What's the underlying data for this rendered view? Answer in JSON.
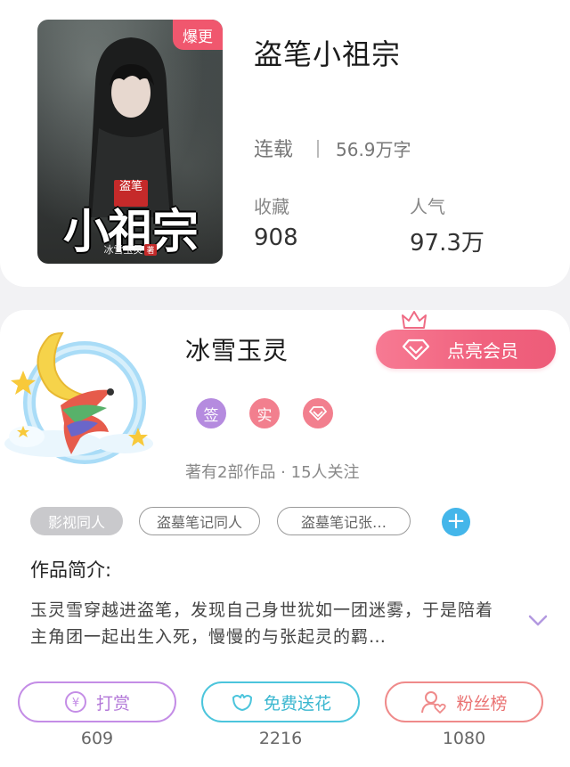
{
  "book": {
    "cover_badge": "爆更",
    "cover_title_small": "盗笔",
    "cover_title_big": "小祖宗",
    "cover_author": "冰雪玉灵",
    "cover_author_mark": "著",
    "title": "盗笔小祖宗",
    "status": "连载",
    "word_count": "56.9万字",
    "favorites_label": "收藏",
    "favorites_value": "908",
    "popularity_label": "人气",
    "popularity_value": "97.3万"
  },
  "author": {
    "name": "冰雪玉灵",
    "vip_button": "点亮会员",
    "badges": [
      {
        "label": "签",
        "color": "#b58bdf"
      },
      {
        "label": "实",
        "color": "#f27f8e"
      },
      {
        "label": "",
        "icon": "diamond-icon",
        "color": "#f27f8e"
      }
    ],
    "stats": "著有2部作品 · 15人关注"
  },
  "tags": [
    "影视同人",
    "盗墓笔记同人",
    "盗墓笔记张…"
  ],
  "intro": {
    "heading": "作品简介:",
    "text": "玉灵雪穿越进盗笔，发现自己身世犹如一团迷雾，于是陪着主角团一起出生入死，慢慢的与张起灵的羁…"
  },
  "actions": [
    {
      "label": "打赏",
      "count": "609",
      "icon": "yen-coin-icon",
      "color": "#c48de6"
    },
    {
      "label": "免费送花",
      "count": "2216",
      "icon": "flower-icon",
      "color": "#4cc5dc"
    },
    {
      "label": "粉丝榜",
      "count": "1080",
      "icon": "user-heart-icon",
      "color": "#ef8a8a"
    }
  ]
}
